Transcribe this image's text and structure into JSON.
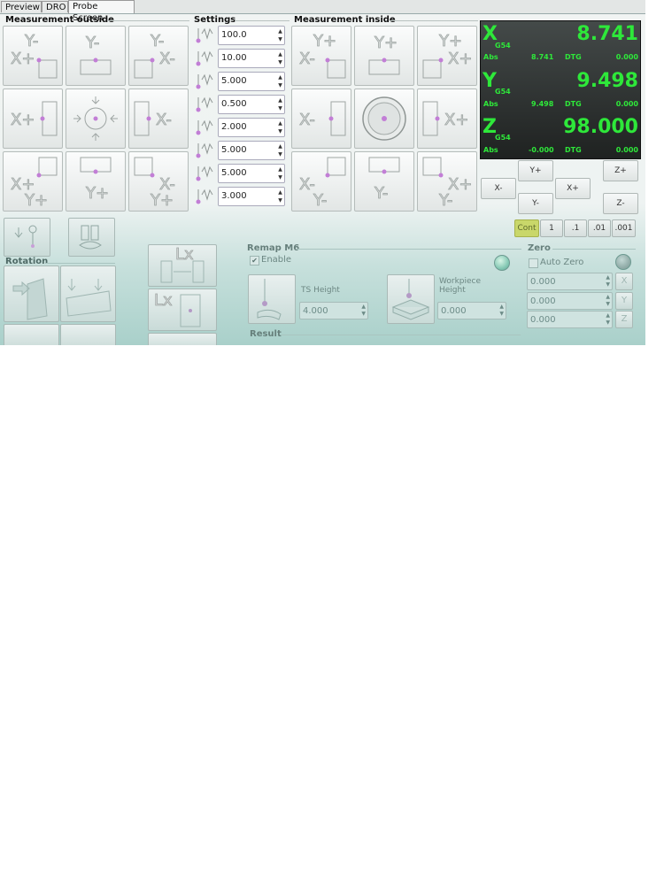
{
  "tabs": [
    "Preview",
    "DRO",
    "Probe Screen"
  ],
  "active_tab": "Probe Screen",
  "groups": {
    "outside": "Measurement outside",
    "settings": "Settings",
    "inside": "Measurement inside",
    "rotation": "Rotation",
    "remap": "Remap M6",
    "zero": "Zero",
    "result": "Result"
  },
  "settings_values": [
    "100.0",
    "10.00",
    "5.000",
    "0.500",
    "2.000",
    "5.000",
    "5.000",
    "3.000"
  ],
  "settings_icons": [
    "probe-fast-feed-icon",
    "probe-slow-feed-icon",
    "probe-diameter-icon",
    "latch-return-icon",
    "max-z-icon",
    "xy-clearance-icon",
    "z-clearance-icon",
    "probe-depth-icon"
  ],
  "outside_buttons": [
    {
      "name": "outside-xm-yp-corner",
      "glyphs": [
        "X+",
        "Y-"
      ]
    },
    {
      "name": "outside-yp-edge",
      "glyphs": [
        "Y-"
      ]
    },
    {
      "name": "outside-xp-yp-corner",
      "glyphs": [
        "X-",
        "Y-"
      ]
    },
    {
      "name": "outside-xm-edge",
      "glyphs": [
        "X+"
      ]
    },
    {
      "name": "outside-center",
      "glyphs": []
    },
    {
      "name": "outside-xp-edge",
      "glyphs": [
        "X-"
      ]
    },
    {
      "name": "outside-xm-ym-corner",
      "glyphs": [
        "X+",
        "Y+"
      ]
    },
    {
      "name": "outside-ym-edge",
      "glyphs": [
        "Y+"
      ]
    },
    {
      "name": "outside-xp-ym-corner",
      "glyphs": [
        "X-",
        "Y+"
      ]
    }
  ],
  "inside_buttons": [
    {
      "name": "inside-xm-yp-corner",
      "glyphs": [
        "X-",
        "Y+"
      ]
    },
    {
      "name": "inside-yp-edge",
      "glyphs": [
        "Y+"
      ]
    },
    {
      "name": "inside-xp-yp-corner",
      "glyphs": [
        "X+",
        "Y+"
      ]
    },
    {
      "name": "inside-xm-edge",
      "glyphs": [
        "X-"
      ]
    },
    {
      "name": "inside-hole",
      "glyphs": []
    },
    {
      "name": "inside-xp-edge",
      "glyphs": [
        "X+"
      ]
    },
    {
      "name": "inside-xm-ym-corner",
      "glyphs": [
        "X-",
        "Y-"
      ]
    },
    {
      "name": "inside-ym-edge",
      "glyphs": [
        "Y-"
      ]
    },
    {
      "name": "inside-xp-ym-corner",
      "glyphs": [
        "X+",
        "Y-"
      ]
    }
  ],
  "dro": {
    "x": {
      "axis": "X",
      "wcs": "G54",
      "value": "8.741",
      "abs_label": "Abs",
      "abs": "8.741",
      "dtg_label": "DTG",
      "dtg": "0.000"
    },
    "y": {
      "axis": "Y",
      "wcs": "G54",
      "value": "9.498",
      "abs_label": "Abs",
      "abs": "9.498",
      "dtg_label": "DTG",
      "dtg": "0.000"
    },
    "z": {
      "axis": "Z",
      "wcs": "G54",
      "value": "98.000",
      "abs_label": "Abs",
      "abs": "-0.000",
      "dtg_label": "DTG",
      "dtg": "0.000"
    },
    "color": "#2ee83a"
  },
  "jog": {
    "y_plus": "Y+",
    "y_minus": "Y-",
    "x_plus": "X+",
    "x_minus": "X-",
    "z_plus": "Z+",
    "z_minus": "Z-"
  },
  "increments": [
    "Cont",
    "1",
    ".1",
    ".01",
    ".001"
  ],
  "active_increment": "Cont",
  "remap": {
    "enable_label": "Enable",
    "enabled": true,
    "ts_height_label": "TS Height",
    "ts_height": "4.000",
    "workpiece_label": "Workpiece Height",
    "workpiece_height": "0.000"
  },
  "zero": {
    "auto_zero_label": "Auto Zero",
    "auto_zero": false,
    "values": [
      "0.000",
      "0.000",
      "0.000"
    ],
    "button_glyphs": [
      "X",
      "Y",
      "Z"
    ]
  },
  "colors": {
    "accent_increment": "#c9d76a",
    "led": "#86c9b5",
    "dro_bg": "#2a2e2d"
  }
}
